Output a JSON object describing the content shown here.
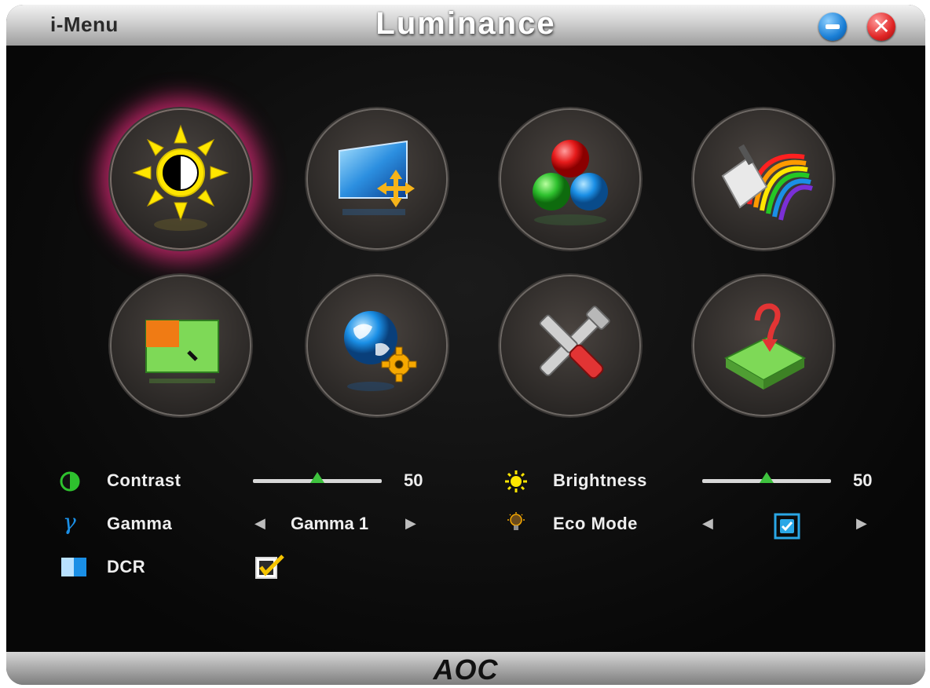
{
  "window": {
    "app_name": "i-Menu",
    "title": "Luminance",
    "minimize_icon": "minimize-icon",
    "close_icon": "close-icon"
  },
  "menu_tiles": [
    {
      "name": "luminance",
      "icon": "brightness-contrast-icon",
      "selected": true
    },
    {
      "name": "image-setup",
      "icon": "screen-move-icon",
      "selected": false
    },
    {
      "name": "color-temp",
      "icon": "rgb-color-icon",
      "selected": false
    },
    {
      "name": "color-boost",
      "icon": "rainbow-paint-icon",
      "selected": false
    },
    {
      "name": "picture-boost",
      "icon": "picture-boost-icon",
      "selected": false
    },
    {
      "name": "osd-setup",
      "icon": "globe-gear-icon",
      "selected": false
    },
    {
      "name": "extra",
      "icon": "tools-icon",
      "selected": false
    },
    {
      "name": "exit",
      "icon": "exit-icon",
      "selected": false
    }
  ],
  "settings": {
    "contrast": {
      "label": "Contrast",
      "value": "50",
      "level": 0.5,
      "icon": "contrast-icon"
    },
    "brightness": {
      "label": "Brightness",
      "value": "50",
      "level": 0.5,
      "icon": "sun-icon"
    },
    "gamma": {
      "label": "Gamma",
      "value": "Gamma 1",
      "icon": "gamma-icon"
    },
    "eco_mode": {
      "label": "Eco Mode",
      "checked": true,
      "icon": "eco-bulb-icon"
    },
    "dcr": {
      "label": "DCR",
      "checked": true,
      "icon": "dcr-icon"
    }
  },
  "footer": {
    "brand": "AOC",
    "refresh_icon": "refresh-icon"
  },
  "colors": {
    "selected_glow": "#cd286e",
    "slider_thumb": "#3ec33e",
    "titlebar": "#cfcfcf"
  }
}
